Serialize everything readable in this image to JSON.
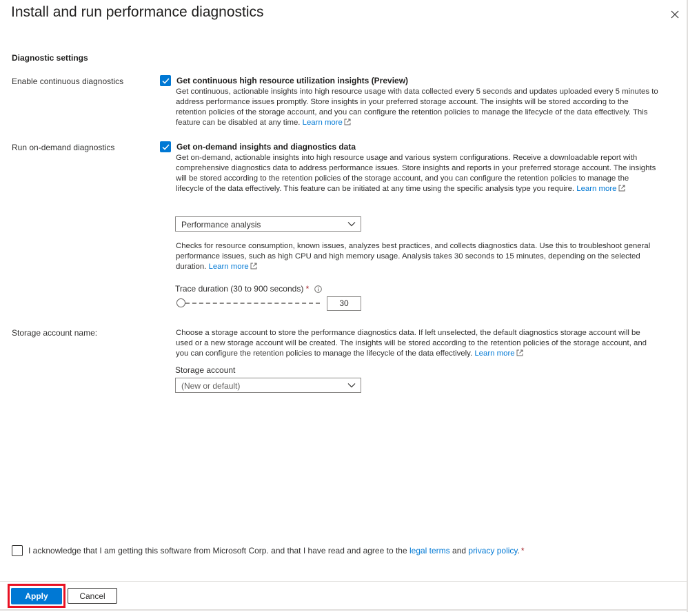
{
  "panel": {
    "title": "Install and run performance diagnostics"
  },
  "settings": {
    "heading": "Diagnostic settings",
    "continuous": {
      "label": "Enable continuous diagnostics",
      "checked": true,
      "option_title": "Get continuous high resource utilization insights (Preview)",
      "description": "Get continuous, actionable insights into high resource usage with data collected every 5 seconds and updates uploaded every 5 minutes to address performance issues promptly. Store insights in your preferred storage account. The insights will be stored according to the retention policies of the storage account, and you can configure the retention policies to manage the lifecycle of the data effectively. This feature can be disabled at any time.",
      "link_text": "Learn more"
    },
    "on_demand": {
      "label": "Run on-demand diagnostics",
      "checked": true,
      "option_title": "Get on-demand insights and diagnostics data",
      "description": "Get on-demand, actionable insights into high resource usage and various system configurations. Receive a downloadable report with comprehensive diagnostics data to address performance issues. Store insights and reports in your preferred storage account. The insights will be stored according to the retention policies of the storage account, and you can configure the retention policies to manage the lifecycle of the data effectively. This feature can be initiated at any time using the specific analysis type you require.",
      "link_text": "Learn more",
      "analysis_type": "Performance analysis",
      "analysis_description": "Checks for resource consumption, known issues, analyzes best practices, and collects diagnostics data. Use this to troubleshoot general performance issues, such as high CPU and high memory usage. Analysis takes 30 seconds to 15 minutes, depending on the selected duration.",
      "analysis_link_text": "Learn more",
      "trace_label": "Trace duration (30 to 900 seconds)",
      "required_mark": "*",
      "trace_value": "30"
    },
    "storage": {
      "label": "Storage account name:",
      "description": "Choose a storage account to store the performance diagnostics data. If left unselected, the default diagnostics storage account will be used or a new storage account will be created. The insights will be stored according to the retention policies of the storage account, and you can configure the retention policies to manage the lifecycle of the data effectively.",
      "link_text": "Learn more",
      "field_label": "Storage account",
      "placeholder": "(New or default)"
    }
  },
  "acknowledge": {
    "checked": false,
    "text": "I acknowledge that I am getting this software from Microsoft Corp. and that I have read and agree to the",
    "legal_link": "legal terms",
    "and_text": "and",
    "privacy_link": "privacy policy",
    "end": ".",
    "required_mark": "*"
  },
  "footer": {
    "apply_label": "Apply",
    "cancel_label": "Cancel"
  },
  "colors": {
    "accent": "#0078d4",
    "highlight": "#e81123",
    "required": "#a4262c"
  },
  "icons": [
    "close-icon",
    "checkmark-icon",
    "external-link-icon",
    "chevron-down-icon",
    "info-icon"
  ]
}
